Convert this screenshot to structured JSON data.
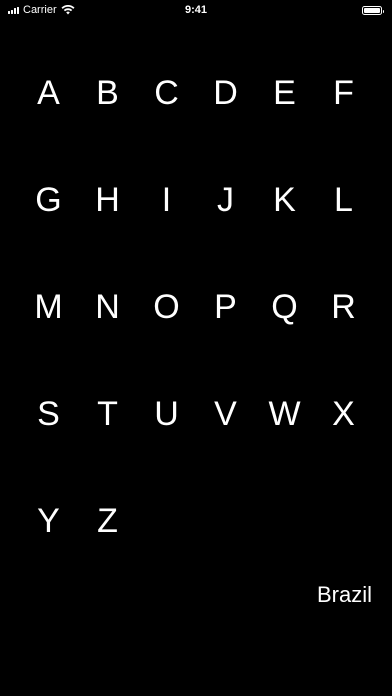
{
  "status_bar": {
    "carrier": "Carrier",
    "time": "9:41",
    "icons": [
      "signal-icon",
      "wifi-icon",
      "battery-icon"
    ]
  },
  "letters": [
    "A",
    "B",
    "C",
    "D",
    "E",
    "F",
    "G",
    "H",
    "I",
    "J",
    "K",
    "L",
    "M",
    "N",
    "O",
    "P",
    "Q",
    "R",
    "S",
    "T",
    "U",
    "V",
    "W",
    "X",
    "Y",
    "Z"
  ],
  "country_label": "Brazil",
  "colors": {
    "background": "#000000",
    "text": "#ffffff"
  }
}
